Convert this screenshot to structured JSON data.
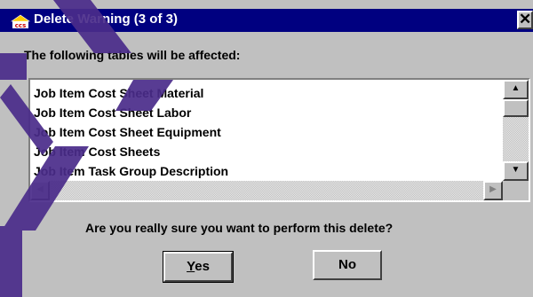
{
  "window": {
    "title": "Delete Warning (3 of 3)",
    "app_icon": "ccs-app-icon",
    "close_label": "✕"
  },
  "message": "The following tables will be affected:",
  "tables_list": {
    "items": [
      "Job Item Cost Sheet Material",
      "Job Item Cost Sheet Labor",
      "Job Item Cost Sheet Equipment",
      "Job Item Cost Sheets",
      "Job Item Task Group Description"
    ],
    "scroll_up": "▲",
    "scroll_down": "▼",
    "scroll_left": "◀",
    "scroll_right": "▶"
  },
  "question": "Are you really sure you want to perform this delete?",
  "buttons": {
    "yes_label": "Yes",
    "yes_mnemonic": "Y",
    "yes_rest": "es",
    "no_label": "No"
  },
  "colors": {
    "titlebar": "#000080",
    "face": "#c0c0c0",
    "watermark": "#4a2c8a"
  }
}
